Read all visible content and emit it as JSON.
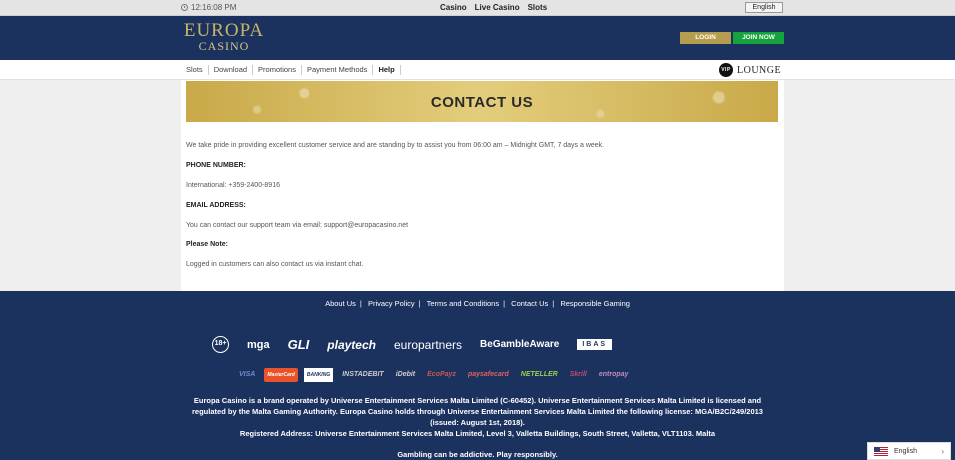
{
  "topbar": {
    "time": "12:16:08 PM",
    "nav": [
      "Casino",
      "Live Casino",
      "Slots"
    ],
    "language": "English"
  },
  "header": {
    "logo_main": "EUROPA",
    "logo_sub": "CASINO",
    "login_label": "LOGIN",
    "join_label": "JOIN NOW"
  },
  "subnav": {
    "items": [
      "Slots",
      "Download",
      "Promotions",
      "Payment Methods",
      "Help"
    ],
    "active": "Help",
    "vip_badge": "VIP",
    "vip_label": "LOUNGE"
  },
  "content": {
    "title": "CONTACT US",
    "intro": "We take pride in providing excellent customer service and are standing by to assist you from 06:00 am – Midnight GMT, 7 days a week.",
    "phone_label": "PHONE NUMBER:",
    "phone_text": "International: +359-2400-8916",
    "email_label": "EMAIL ADDRESS:",
    "email_text": "You can contact our support team via email: support@europacasino.net",
    "note_label": "Please Note:",
    "note_text": "Logged in customers can also contact us via instant chat."
  },
  "footer": {
    "links": [
      "About Us",
      "Privacy Policy",
      "Terms and Conditions",
      "Contact Us",
      "Responsible Gaming"
    ],
    "partners": [
      "18+",
      "mga",
      "GLI",
      "playtech",
      "europartners",
      "BeGambleAware",
      "IBAS"
    ],
    "payments": [
      "VISA",
      "MasterCard",
      "BANKING",
      "INSTADEBIT",
      "iDebit",
      "EcoPayz",
      "paysafecard",
      "NETELLER",
      "Skrill",
      "entropay"
    ],
    "brand_text": "Europa Casino is a brand operated by Universe Entertainment Services Malta Limited (C-60452). Universe Entertainment Services Malta Limited is licensed and regulated by the Malta Gaming Authority. Europa Casino holds through Universe Entertainment Services Malta Limited the following license: MGA/B2C/249/2013 (issued: August 1st, 2018).",
    "address_text": "Registered Address: Universe Entertainment Services Malta Limited, Level 3, Valletta Buildings, South Street, Valletta, VLT1103. Malta",
    "gambling_text": "Gambling can be addictive. Play responsibly."
  },
  "lang_widget": {
    "label": "English"
  },
  "colors": {
    "navy": "#1b325f",
    "gold": "#b59d4f",
    "green": "#14a33c"
  }
}
